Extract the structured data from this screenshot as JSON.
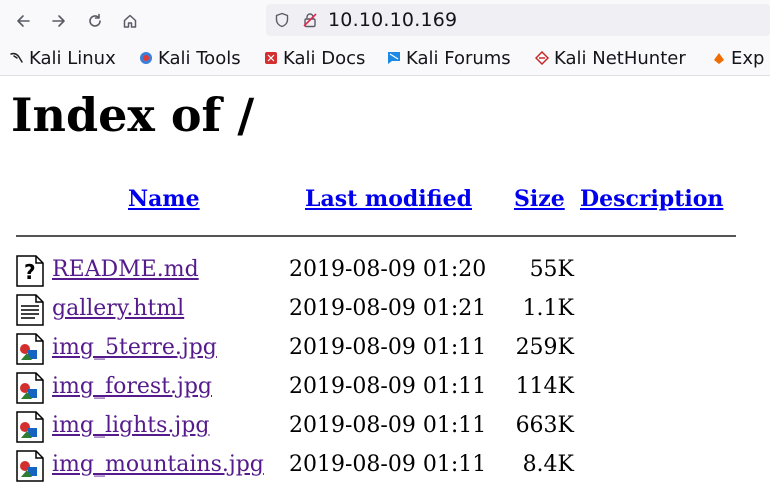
{
  "browser": {
    "url": "10.10.10.169",
    "bookmarks": [
      {
        "label": "Kali Linux",
        "icon": "kali-dragon-icon"
      },
      {
        "label": "Kali Tools",
        "icon": "kali-tools-icon"
      },
      {
        "label": "Kali Docs",
        "icon": "kali-docs-icon"
      },
      {
        "label": "Kali Forums",
        "icon": "kali-forums-icon"
      },
      {
        "label": "Kali NetHunter",
        "icon": "kali-nethunter-icon"
      },
      {
        "label": "Exp",
        "icon": "exploit-db-icon"
      }
    ]
  },
  "page": {
    "title": "Index of /",
    "columns": {
      "name": "Name",
      "last_modified": "Last modified",
      "size": "Size",
      "description": "Description"
    },
    "files": [
      {
        "name": "README.md",
        "date": "2019-08-09 01:20",
        "size": "55K",
        "icon": "unknown-file-icon"
      },
      {
        "name": "gallery.html",
        "date": "2019-08-09 01:21",
        "size": "1.1K",
        "icon": "text-file-icon"
      },
      {
        "name": "img_5terre.jpg",
        "date": "2019-08-09 01:11",
        "size": "259K",
        "icon": "image-file-icon"
      },
      {
        "name": "img_forest.jpg",
        "date": "2019-08-09 01:11",
        "size": "114K",
        "icon": "image-file-icon"
      },
      {
        "name": "img_lights.jpg",
        "date": "2019-08-09 01:11",
        "size": "663K",
        "icon": "image-file-icon"
      },
      {
        "name": "img_mountains.jpg",
        "date": "2019-08-09 01:11",
        "size": "8.4K",
        "icon": "image-file-icon"
      }
    ]
  },
  "colors": {
    "link": "#0000ee",
    "visited": "#551a8b",
    "toolbar": "#f9f9fb",
    "urlbar": "#f0f0f4"
  }
}
